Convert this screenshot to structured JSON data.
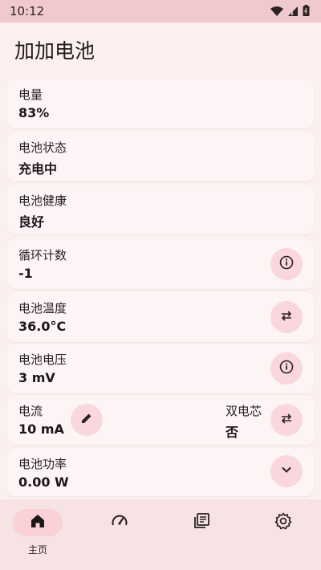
{
  "status_bar": {
    "time": "10:12"
  },
  "app": {
    "title": "加加电池"
  },
  "cards": {
    "capacity": {
      "label": "电量",
      "value": "83%"
    },
    "status": {
      "label": "电池状态",
      "value": "充电中"
    },
    "health": {
      "label": "电池健康",
      "value": "良好"
    },
    "cycles": {
      "label": "循环计数",
      "value": "-1"
    },
    "temperature": {
      "label": "电池温度",
      "value": "36.0°C"
    },
    "voltage": {
      "label": "电池电压",
      "value": "3 mV"
    },
    "current": {
      "label": "电流",
      "value": "10 mA",
      "dual_label": "双电芯",
      "dual_value": "否"
    },
    "power": {
      "label": "电池功率",
      "value": "0.00 W"
    }
  },
  "nav": {
    "home_label": "主页",
    "items": [
      {
        "icon": "home-icon"
      },
      {
        "icon": "speedometer-icon"
      },
      {
        "icon": "document-list-icon"
      },
      {
        "icon": "gear-icon"
      }
    ]
  },
  "colors": {
    "background": "#fcefef",
    "card": "#fdf5f5",
    "accent": "#f9d7dc",
    "status_bar": "#efc9cd",
    "nav_bar": "#f7e3e4"
  }
}
